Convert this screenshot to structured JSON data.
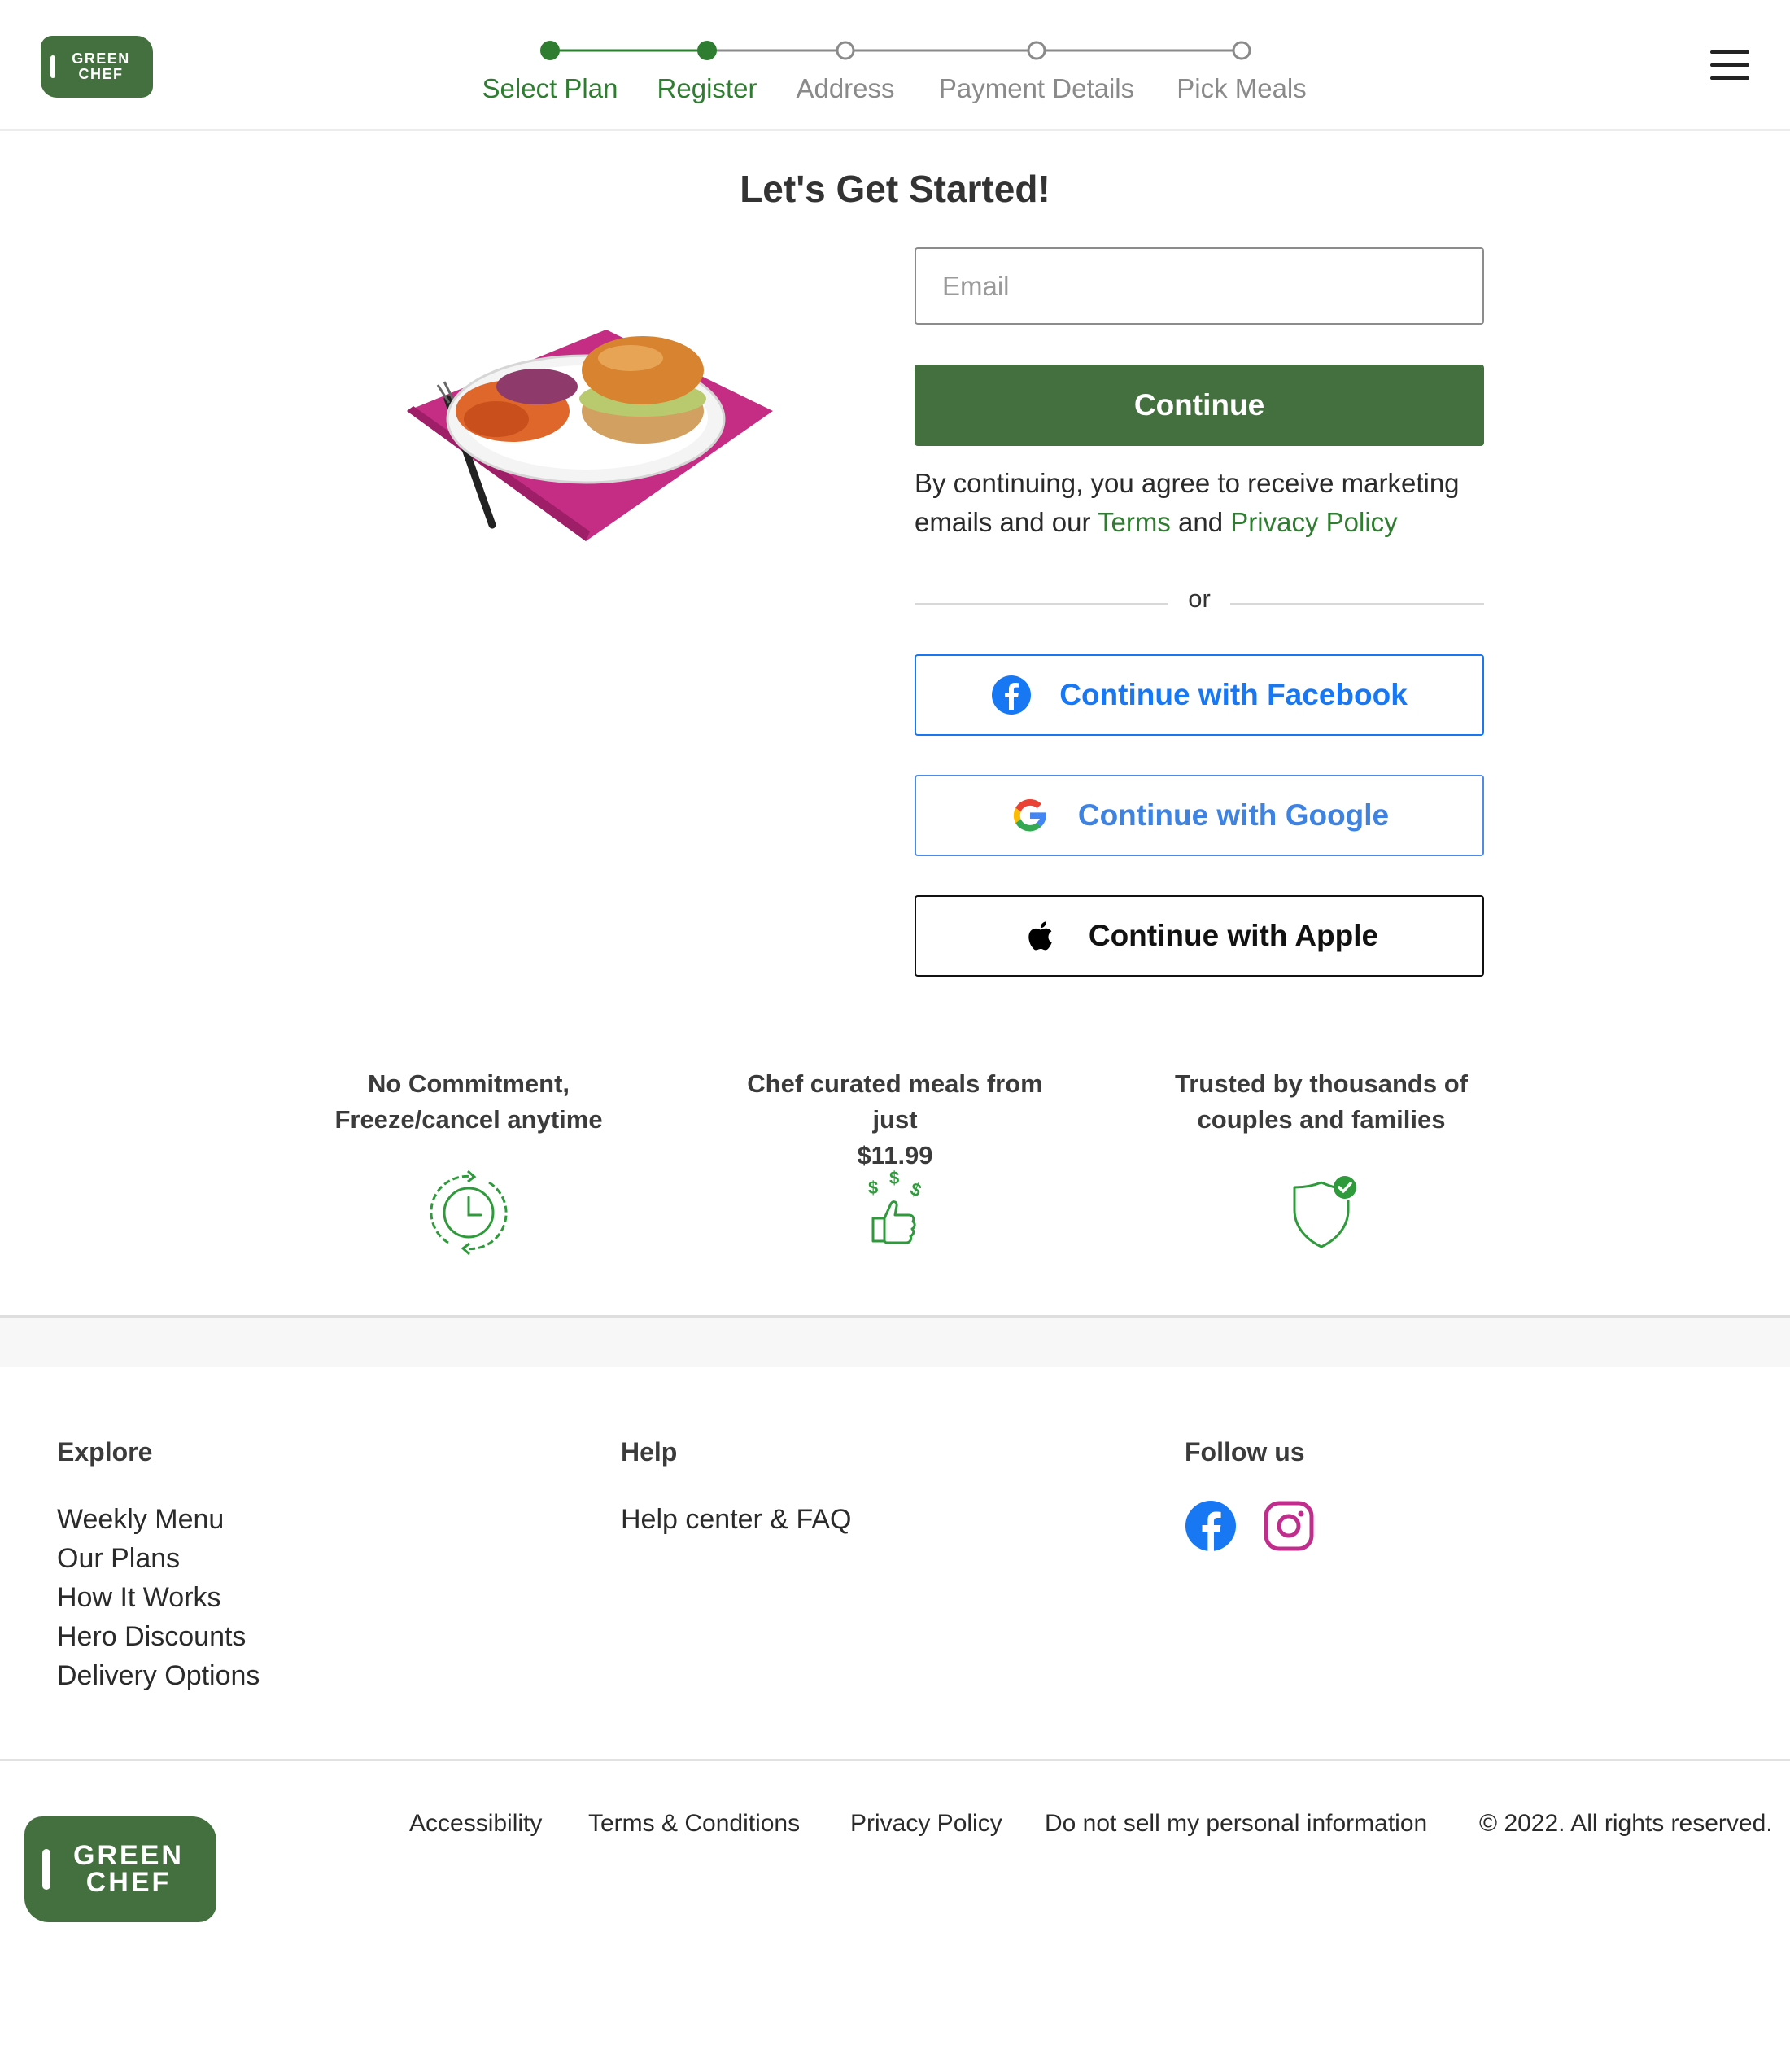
{
  "brand": {
    "logo_text_line1": "GREEN",
    "logo_text_line2": "CHEF",
    "accent_color": "#43703e",
    "step_done_color": "#2f7d31"
  },
  "stepper": {
    "steps": [
      {
        "label": "Select Plan",
        "state": "done"
      },
      {
        "label": "Register",
        "state": "current"
      },
      {
        "label": "Address",
        "state": "todo"
      },
      {
        "label": "Payment Details",
        "state": "todo"
      },
      {
        "label": "Pick Meals",
        "state": "todo"
      }
    ]
  },
  "header": {
    "menu_icon": "hamburger-menu-icon"
  },
  "main": {
    "title": "Let's Get Started!",
    "email_placeholder": "Email",
    "email_value": "",
    "continue_label": "Continue",
    "consent_prefix": "By continuing, you agree to receive marketing emails and our ",
    "consent_terms": "Terms",
    "consent_and": " and ",
    "consent_privacy": "Privacy Policy",
    "or_text": "or",
    "facebook_label": "Continue with Facebook",
    "google_label": "Continue with Google",
    "apple_label": "Continue with Apple",
    "facebook_color": "#1877f2",
    "google_color": "#3e82e2"
  },
  "features": [
    {
      "line1": "No Commitment,",
      "line2": "Freeze/cancel anytime",
      "icon": "clock-refresh-icon"
    },
    {
      "line1": "Chef curated meals from just",
      "line2": "$11.99",
      "icon": "thumbs-up-dollar-icon"
    },
    {
      "line1": "Trusted by thousands of",
      "line2": "couples and families",
      "icon": "shield-check-icon"
    }
  ],
  "footer": {
    "explore": {
      "heading": "Explore",
      "links": [
        "Weekly Menu",
        "Our Plans",
        "How It Works",
        "Hero Discounts",
        "Delivery Options"
      ]
    },
    "help": {
      "heading": "Help",
      "links": [
        "Help center & FAQ"
      ]
    },
    "follow": {
      "heading": "Follow us",
      "icons": [
        "facebook-icon",
        "instagram-icon"
      ]
    },
    "legal": {
      "accessibility": "Accessibility",
      "terms": "Terms & Conditions",
      "privacy": "Privacy Policy",
      "do_not_sell": "Do not sell my personal information",
      "copyright": "© 2022. All rights reserved."
    }
  }
}
